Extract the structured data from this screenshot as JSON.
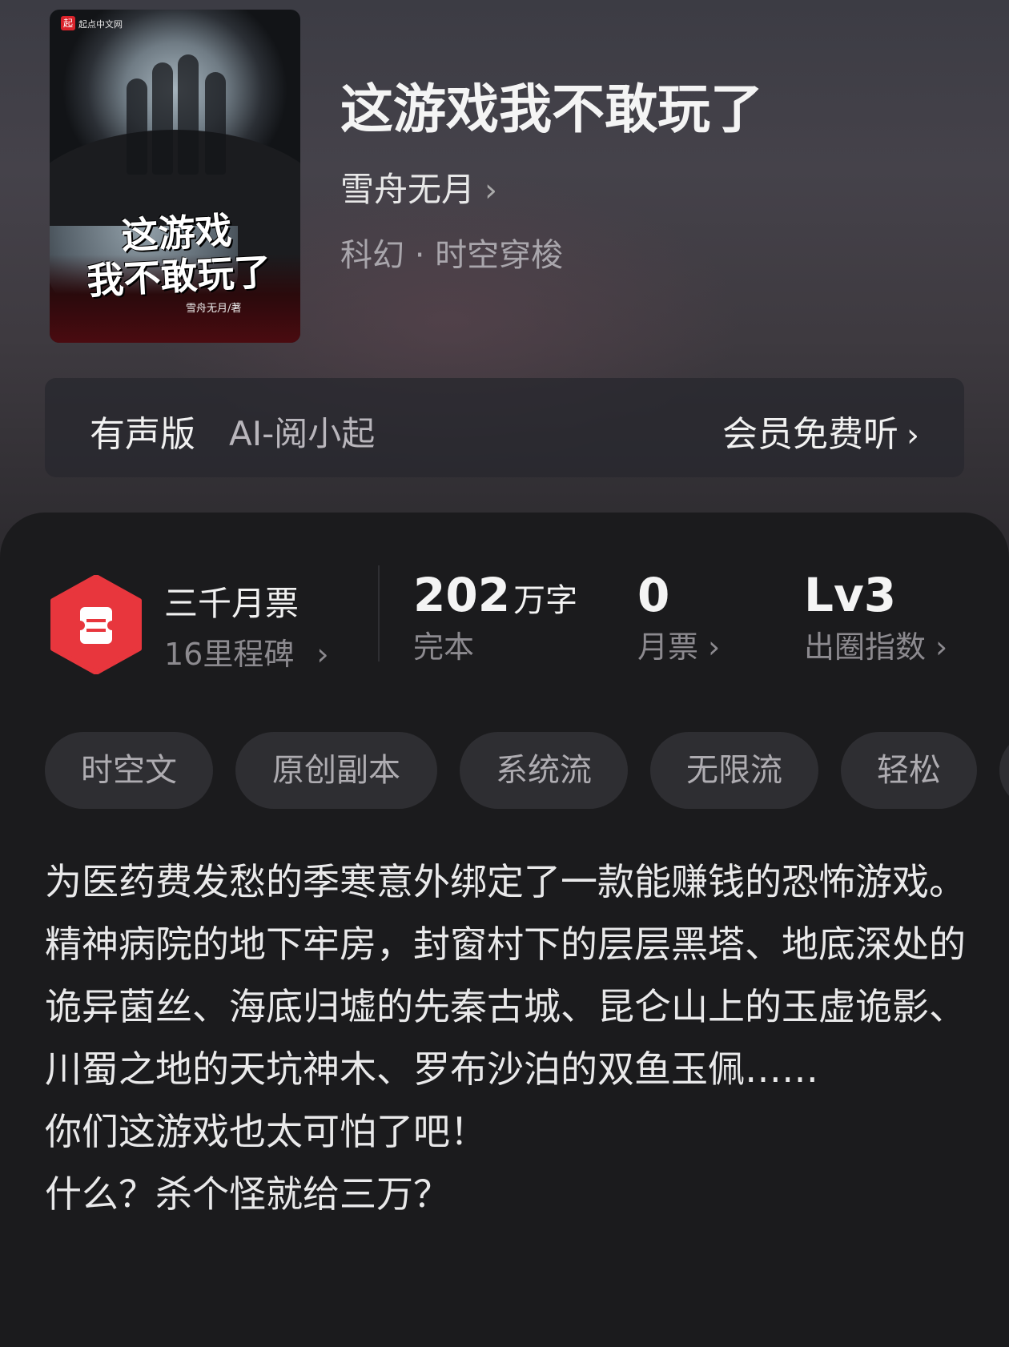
{
  "cover": {
    "publisher": "起点中文网",
    "publisher_logo": "起",
    "title_line1": "这游戏",
    "title_line2": "我不敢玩了",
    "author": "雪舟无月/著"
  },
  "book": {
    "title": "这游戏我不敢玩了",
    "author": "雪舟无月",
    "genre": "科幻 · 时空穿梭"
  },
  "audio": {
    "label": "有声版",
    "narrator": "AI-阅小起",
    "action": "会员免费听"
  },
  "ticket": {
    "title": "三千月票",
    "subtitle": "16里程碑",
    "icon": "ticket-icon",
    "color": "#e8363d"
  },
  "stats": [
    {
      "value": "202",
      "unit": "万字",
      "label": "完本"
    },
    {
      "value": "0",
      "unit": "",
      "label": "月票"
    },
    {
      "value": "Lv3",
      "unit": "",
      "label": "出圈指数"
    }
  ],
  "tags": [
    "时空文",
    "原创副本",
    "系统流",
    "无限流",
    "轻松"
  ],
  "synopsis": [
    "为医药费发愁的季寒意外绑定了一款能赚钱的恐怖游戏。",
    "精神病院的地下牢房，封窗村下的层层黑塔、地底深处的诡异菌丝、海底归墟的先秦古城、昆仑山上的玉虚诡影、川蜀之地的天坑神木、罗布沙泊的双鱼玉佩……",
    "你们这游戏也太可怕了吧！",
    "什么？杀个怪就给三万？"
  ]
}
